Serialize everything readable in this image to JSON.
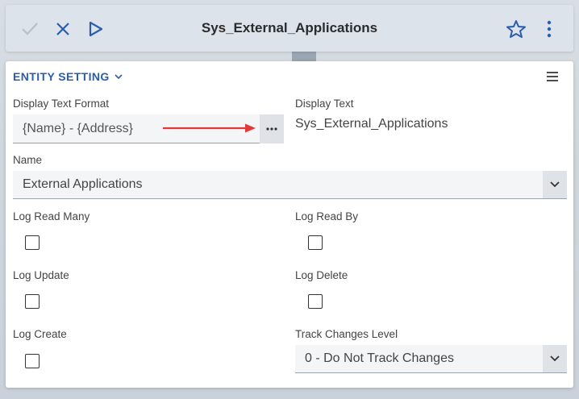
{
  "toolbar": {
    "title": "Sys_External_Applications",
    "icons": [
      "check-icon",
      "close-icon",
      "play-icon",
      "star-icon",
      "more-vertical-icon"
    ]
  },
  "section": {
    "title": "ENTITY SETTING"
  },
  "fields": {
    "display_text_format": {
      "label": "Display Text Format",
      "value": "{Name} - {Address}"
    },
    "display_text": {
      "label": "Display Text",
      "value": "Sys_External_Applications"
    },
    "name": {
      "label": "Name",
      "value": "External Applications"
    },
    "log_read_many": {
      "label": "Log Read Many",
      "checked": false
    },
    "log_read_by": {
      "label": "Log Read By",
      "checked": false
    },
    "log_update": {
      "label": "Log Update",
      "checked": false
    },
    "log_delete": {
      "label": "Log Delete",
      "checked": false
    },
    "log_create": {
      "label": "Log Create",
      "checked": false
    },
    "track_changes_level": {
      "label": "Track Changes Level",
      "value": "0 - Do Not Track Changes"
    }
  },
  "colors": {
    "accent": "#2a5db0",
    "annotation_arrow": "#e03a3a",
    "disabled_icon": "#b8c0c9"
  }
}
